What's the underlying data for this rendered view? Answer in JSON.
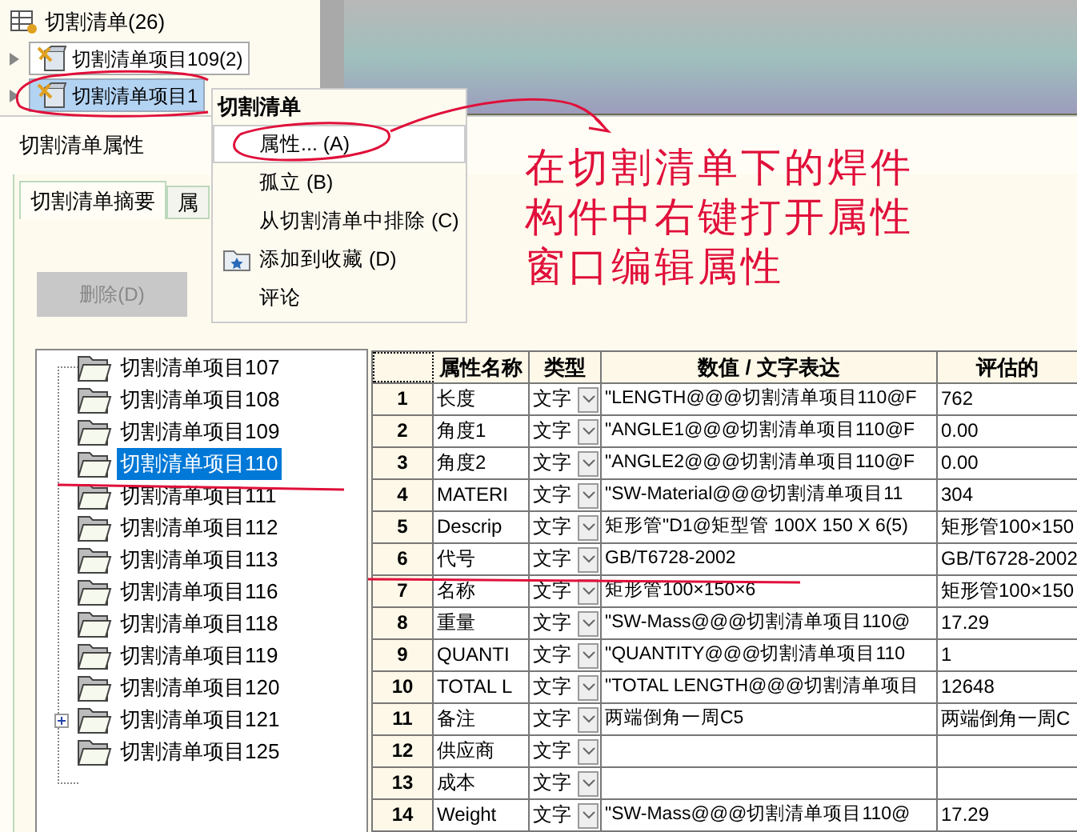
{
  "feature_tree": {
    "root": "切割清单(26)",
    "items": [
      {
        "label": "切割清单项目109(2)",
        "selected": false
      },
      {
        "label": "切割清单项目1",
        "selected": true
      }
    ]
  },
  "dialog": {
    "title": "切割清单属性",
    "tabs": [
      {
        "label": "切割清单摘要",
        "selected": true
      },
      {
        "label": "属",
        "selected": false
      }
    ],
    "delete_button": {
      "label": "删除(D)",
      "disabled": true
    },
    "tree": [
      {
        "label": "切割清单项目107",
        "selected": false,
        "expandable": false
      },
      {
        "label": "切割清单项目108",
        "selected": false,
        "expandable": false
      },
      {
        "label": "切割清单项目109",
        "selected": false,
        "expandable": false
      },
      {
        "label": "切割清单项目110",
        "selected": true,
        "expandable": false
      },
      {
        "label": "切割清单项目111",
        "selected": false,
        "expandable": false
      },
      {
        "label": "切割清单项目112",
        "selected": false,
        "expandable": false
      },
      {
        "label": "切割清单项目113",
        "selected": false,
        "expandable": false
      },
      {
        "label": "切割清单项目116",
        "selected": false,
        "expandable": false
      },
      {
        "label": "切割清单项目118",
        "selected": false,
        "expandable": false
      },
      {
        "label": "切割清单项目119",
        "selected": false,
        "expandable": false
      },
      {
        "label": "切割清单项目120",
        "selected": false,
        "expandable": false
      },
      {
        "label": "切割清单项目121",
        "selected": false,
        "expandable": true
      },
      {
        "label": "切割清单项目125",
        "selected": false,
        "expandable": false
      }
    ],
    "table": {
      "columns": [
        "属性名称",
        "类型",
        "数值 / 文字表达",
        "评估的"
      ],
      "rows": [
        {
          "number": "1",
          "name": "长度",
          "type": "文字",
          "value": "\"LENGTH@@@切割清单项目110@F",
          "evaluated": "762"
        },
        {
          "number": "2",
          "name": "角度1",
          "type": "文字",
          "value": "\"ANGLE1@@@切割清单项目110@F",
          "evaluated": "0.00"
        },
        {
          "number": "3",
          "name": "角度2",
          "type": "文字",
          "value": "\"ANGLE2@@@切割清单项目110@F",
          "evaluated": "0.00"
        },
        {
          "number": "4",
          "name": "MATERI",
          "type": "文字",
          "value": "\"SW-Material@@@切割清单项目11",
          "evaluated": "304"
        },
        {
          "number": "5",
          "name": "Descrip",
          "type": "文字",
          "value": "矩形管\"D1@矩型管 100X 150 X 6(5)",
          "evaluated": "矩形管100×150"
        },
        {
          "number": "6",
          "name": "代号",
          "type": "文字",
          "value": "GB/T6728-2002",
          "evaluated": "GB/T6728-2002"
        },
        {
          "number": "7",
          "name": "名称",
          "type": "文字",
          "value": "矩形管100×150×6",
          "evaluated": "矩形管100×150"
        },
        {
          "number": "8",
          "name": "重量",
          "type": "文字",
          "value": "\"SW-Mass@@@切割清单项目110@",
          "evaluated": "17.29"
        },
        {
          "number": "9",
          "name": "QUANTI",
          "type": "文字",
          "value": "\"QUANTITY@@@切割清单项目110",
          "evaluated": "1"
        },
        {
          "number": "10",
          "name": "TOTAL L",
          "type": "文字",
          "value": "\"TOTAL LENGTH@@@切割清单项目",
          "evaluated": "12648"
        },
        {
          "number": "11",
          "name": "备注",
          "type": "文字",
          "value": "两端倒角一周C5",
          "evaluated": "两端倒角一周C"
        },
        {
          "number": "12",
          "name": "供应商",
          "type": "文字"
        },
        {
          "number": "13",
          "name": "成本",
          "type": "文字"
        },
        {
          "number": "14",
          "name": "Weight",
          "type": "文字",
          "value": "\"SW-Mass@@@切割清单项目110@",
          "evaluated": "17.29"
        }
      ]
    }
  },
  "context_menu": {
    "title": "切割清单",
    "items": [
      {
        "label": "属性... (A)",
        "selected": true,
        "icon": false
      },
      {
        "label": "孤立 (B)",
        "selected": false,
        "icon": false
      },
      {
        "label": "从切割清单中排除 (C)",
        "selected": false,
        "icon": false
      },
      {
        "label": "添加到收藏 (D)",
        "selected": false,
        "icon": true
      },
      {
        "label": "评论",
        "selected": false,
        "icon": false
      }
    ]
  },
  "annotation": {
    "lines": [
      "在切割清单下的焊件",
      "构件中右键打开属性",
      "窗口编辑属性"
    ]
  }
}
